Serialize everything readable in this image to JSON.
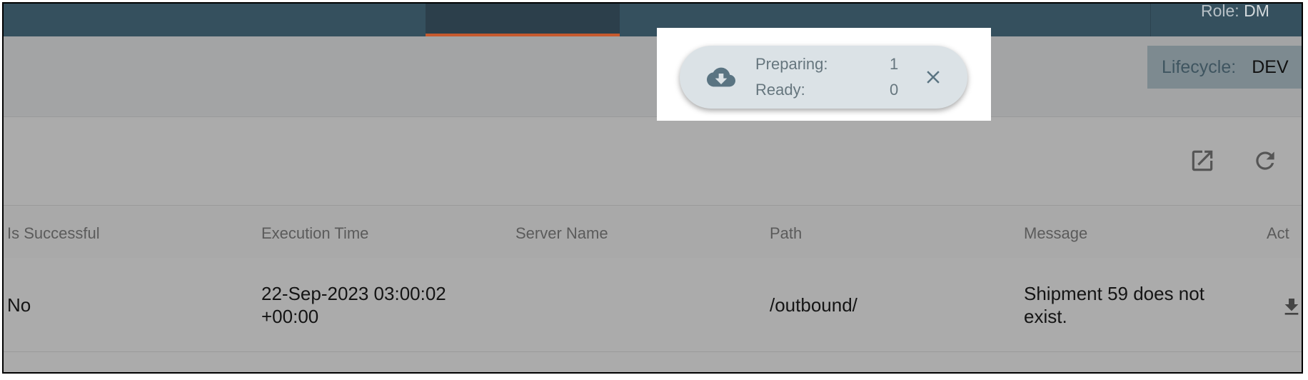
{
  "header": {
    "role_label": "Role:",
    "role_value": "DM"
  },
  "lifecycle": {
    "label": "Lifecycle:",
    "value": "DEV"
  },
  "download_status": {
    "preparing_label": "Preparing:",
    "preparing_count": "1",
    "ready_label": "Ready:",
    "ready_count": "0",
    "icon": "cloud-download-icon",
    "close_icon": "close-icon"
  },
  "toolbar": {
    "icons": [
      "open-in-new-icon",
      "refresh-icon"
    ]
  },
  "table": {
    "columns": [
      "Is Successful",
      "Execution Time",
      "Server Name",
      "Path",
      "Message",
      "Act"
    ],
    "rows": [
      {
        "is_successful": "No",
        "execution_time_line1": "22-Sep-2023 03:00:02",
        "execution_time_line2": "+00:00",
        "server_name": "",
        "path": "/outbound/",
        "message_line1": "Shipment 59 does not",
        "message_line2": "exist.",
        "action_icon": "download-icon"
      }
    ]
  },
  "colors": {
    "topbar": "#35505e",
    "active_tab_indicator": "#c65a2e",
    "overlay_gray": "#ababab",
    "popup_bg": "#dbe2e6"
  }
}
